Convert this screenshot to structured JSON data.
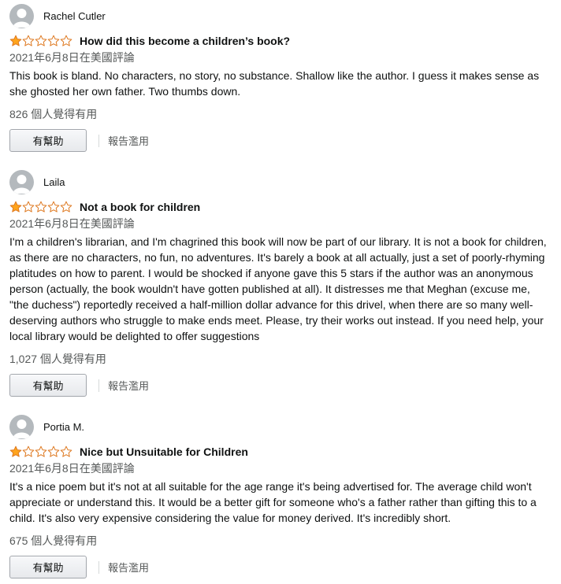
{
  "reviews": [
    {
      "reviewer": "Rachel Cutler",
      "rating": 1,
      "max_rating": 5,
      "title": "How did this become a children’s book?",
      "date": "2021年6月8日在美國評論",
      "body": "This book is bland. No characters, no story, no substance. Shallow like the author. I guess it makes sense as she ghosted her own father. Two thumbs down.",
      "helpful_count": "826 個人覺得有用",
      "helpful_label": "有幫助",
      "report_label": "報告濫用"
    },
    {
      "reviewer": "Laila",
      "rating": 1,
      "max_rating": 5,
      "title": "Not a book for children",
      "date": "2021年6月8日在美國評論",
      "body": "I'm a children's librarian, and I'm chagrined this book will now be part of our library. It is not a book for children, as there are no characters, no fun, no adventures. It's barely a book at all actually, just a set of poorly-rhyming platitudes on how to parent. I would be shocked if anyone gave this 5 stars if the author was an anonymous person (actually, the book wouldn't have gotten published at all). It distresses me that Meghan (excuse me, \"the duchess\") reportedly received a half-million dollar advance for this drivel, when there are so many well-deserving authors who struggle to make ends meet. Please, try their works out instead. If you need help, your local library would be delighted to offer suggestions",
      "helpful_count": "1,027 個人覺得有用",
      "helpful_label": "有幫助",
      "report_label": "報告濫用"
    },
    {
      "reviewer": "Portia M.",
      "rating": 1,
      "max_rating": 5,
      "title": "Nice but Unsuitable for Children",
      "date": "2021年6月8日在美國評論",
      "body": "It's a nice poem but it's not at all suitable for the age range it's being advertised for. The average child won't appreciate or understand this. It would be a better gift for someone who's a father rather than gifting this to a child. It's also very expensive considering the value for money derived. It's incredibly short.",
      "helpful_count": "675 個人覺得有用",
      "helpful_label": "有幫助",
      "report_label": "報告濫用"
    }
  ],
  "icons": {
    "avatar": "default-profile-avatar-icon",
    "star_filled": "star-filled-icon",
    "star_empty": "star-empty-icon"
  },
  "colors": {
    "star": "#ffa41c",
    "star_outline": "#de7921",
    "secondary_text": "#565959",
    "avatar_bg": "#b4b9bd"
  }
}
